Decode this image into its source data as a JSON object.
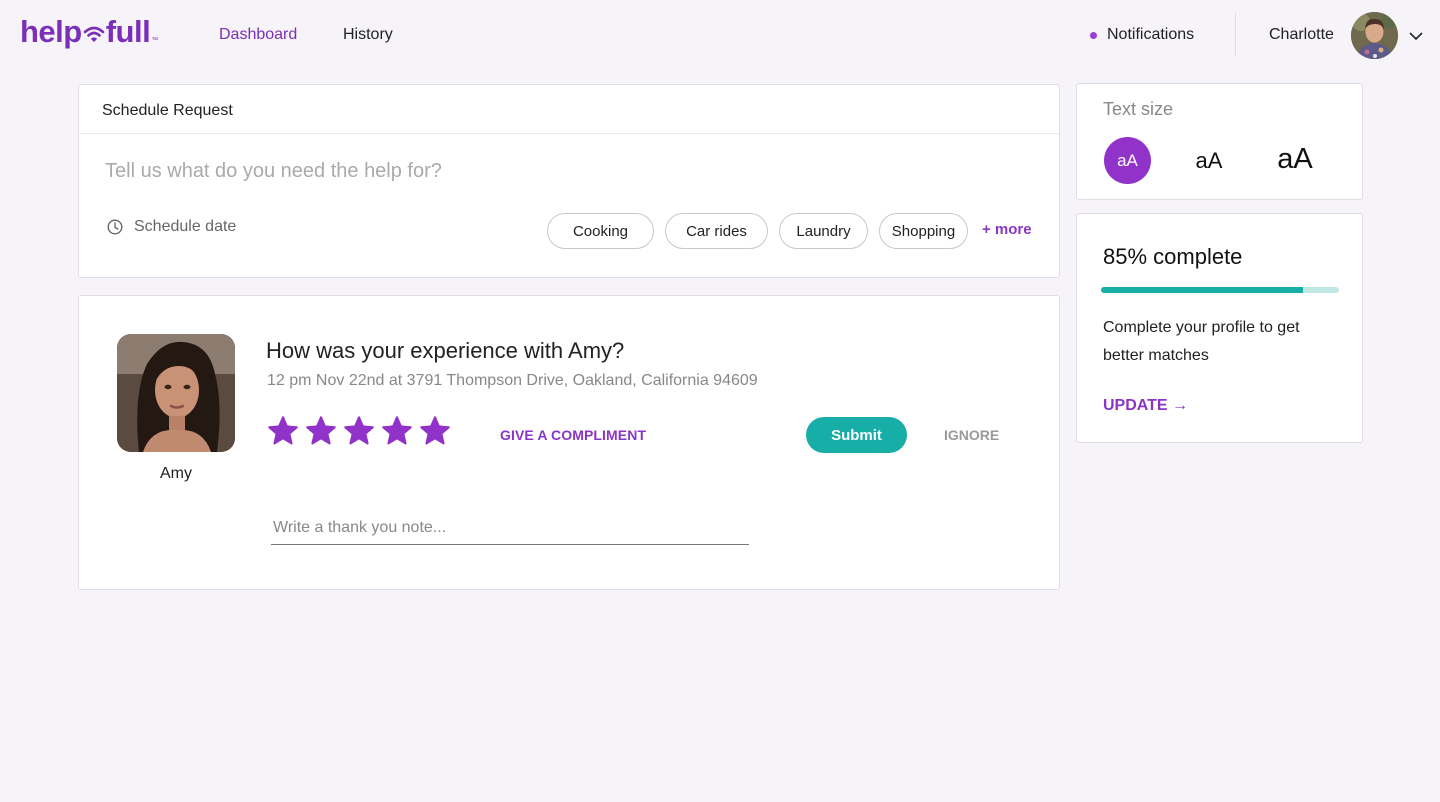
{
  "brand": {
    "logo_left": "help",
    "logo_right": "full",
    "logo_tm": "™",
    "accent": "#8a35c6",
    "teal": "#16aea6"
  },
  "nav": {
    "dashboard": "Dashboard",
    "history": "History"
  },
  "header": {
    "notifications": "Notifications",
    "user_name": "Charlotte"
  },
  "schedule": {
    "title": "Schedule Request",
    "placeholder": "Tell us what do you need the help for?",
    "date_label": "Schedule date",
    "chips": [
      "Cooking",
      "Car rides",
      "Laundry",
      "Shopping"
    ],
    "more": "+ more"
  },
  "review": {
    "helper_name": "Amy",
    "question": "How was your experience with Amy?",
    "details": "12 pm Nov 22nd at 3791 Thompson Drive, Oakland, California 94609",
    "rating": 5,
    "compliment": "GIVE A COMPLIMENT",
    "submit": "Submit",
    "ignore": "IGNORE",
    "note_placeholder": "Write a thank you note..."
  },
  "text_size": {
    "label": "Text size",
    "small": "aA",
    "medium": "aA",
    "large": "aA",
    "selected": "small"
  },
  "profile": {
    "title": "85% complete",
    "progress_percent": 85,
    "text": "Complete your profile to get better matches",
    "update": "UPDATE →"
  },
  "icons": [
    "wifi-heart-logo-icon",
    "clock-icon",
    "star-icon",
    "chevron-down-icon"
  ]
}
